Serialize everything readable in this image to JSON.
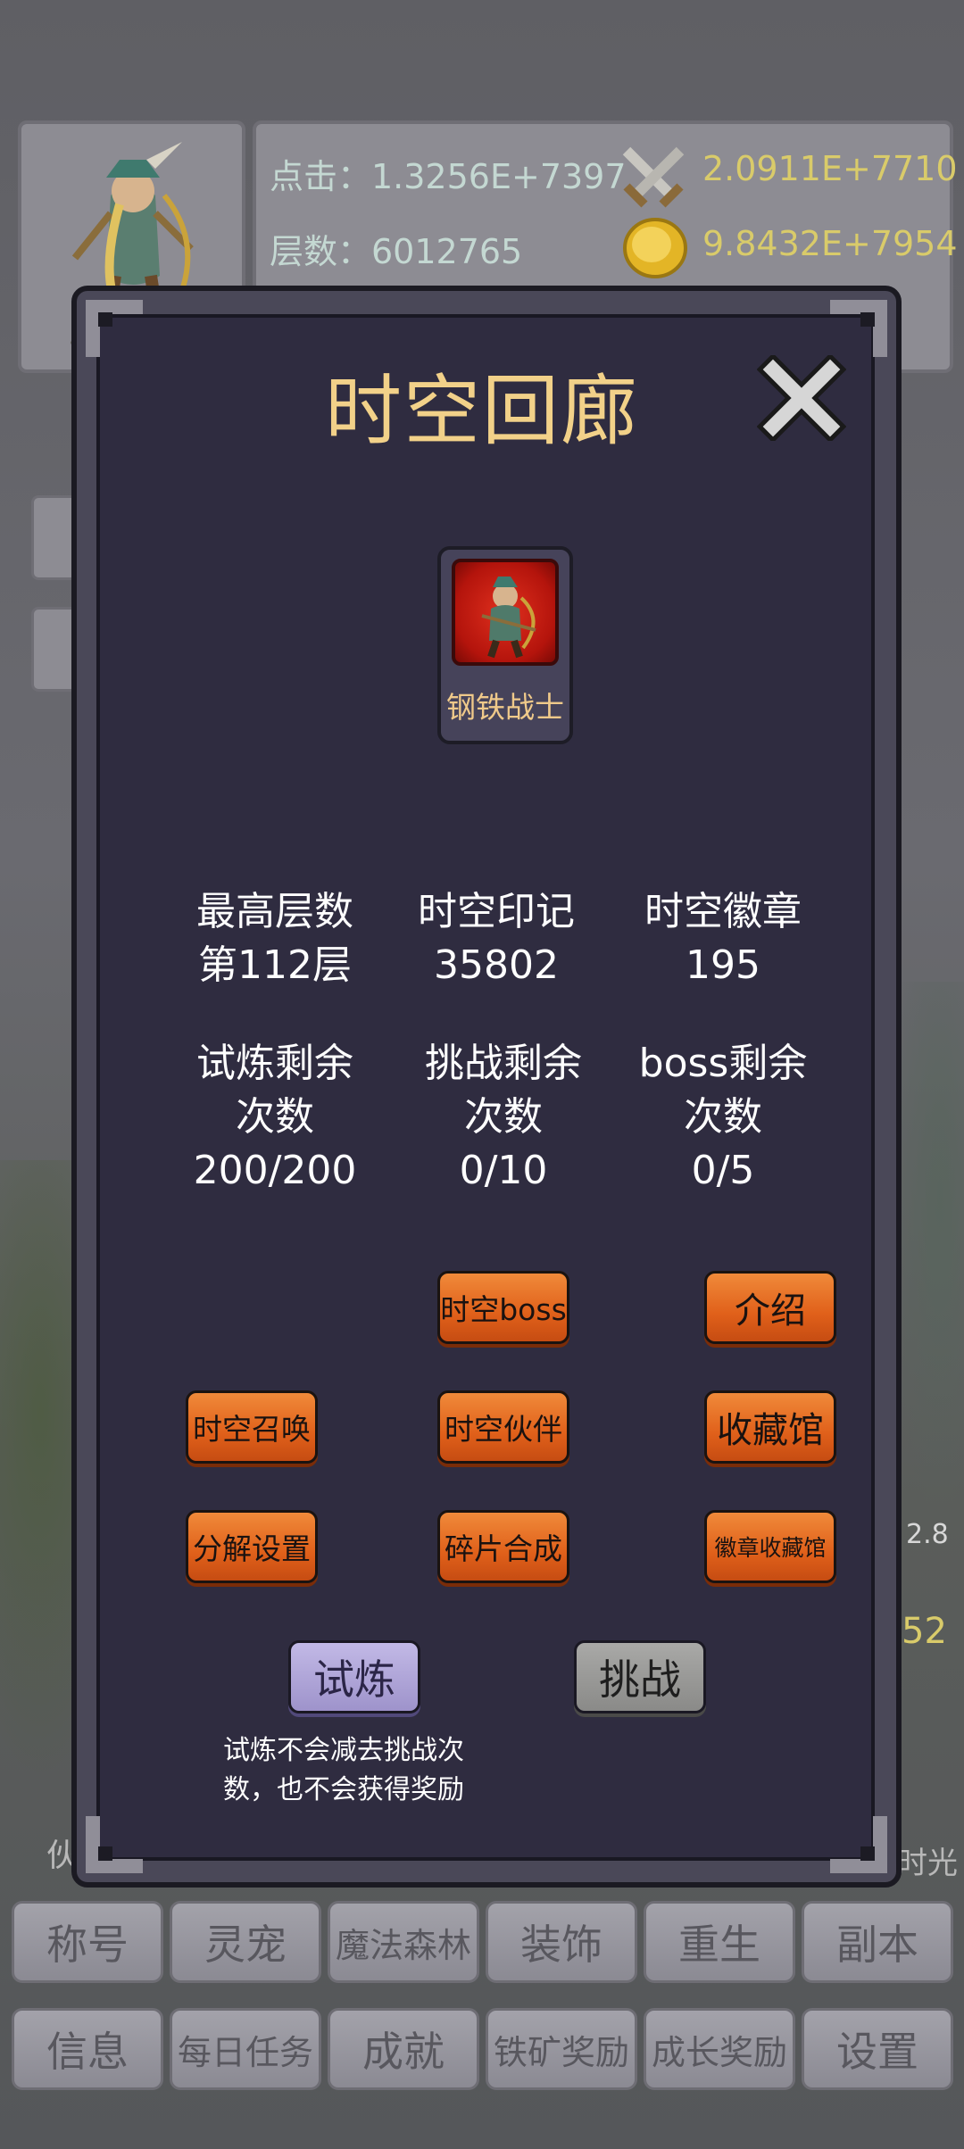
{
  "header": {
    "click_label": "点击：1.3256E+7397",
    "floor_label": "层数：6012765",
    "attack_value": "2.0911E+7710",
    "gold_value": "9.8432E+7954"
  },
  "background": {
    "side_value_1": "2.8",
    "side_value_2": "52",
    "side_text_left": "伙",
    "side_text_right": "时光"
  },
  "modal": {
    "title": "时空回廊",
    "character_name": "钢铁战士",
    "stats": [
      {
        "label": "最高层数",
        "value": "第112层"
      },
      {
        "label": "时空印记",
        "value": "35802"
      },
      {
        "label": "时空徽章",
        "value": "195"
      }
    ],
    "remaining": [
      {
        "label1": "试炼剩余",
        "label2": "次数",
        "value": "200/200"
      },
      {
        "label1": "挑战剩余",
        "label2": "次数",
        "value": "0/10"
      },
      {
        "label1": "boss剩余",
        "label2": "次数",
        "value": "0/5"
      }
    ],
    "buttons": {
      "boss": "时空boss",
      "intro": "介绍",
      "summon": "时空召唤",
      "partner": "时空伙伴",
      "collection": "收藏馆",
      "decompose": "分解设置",
      "fragment": "碎片合成",
      "badge_collection": "徽章收藏馆"
    },
    "trial": "试炼",
    "challenge": "挑战",
    "note": "试炼不会减去挑战次数，也不会获得奖励"
  },
  "menu": {
    "row1": [
      "称号",
      "灵宠",
      "魔法森林",
      "装饰",
      "重生",
      "副本"
    ],
    "row2": [
      "信息",
      "每日任务",
      "成就",
      "铁矿奖励",
      "成长奖励",
      "设置"
    ]
  },
  "colors": {
    "accent_orange": "#e0601a",
    "title_gold": "#f2d189",
    "modal_bg": "#2f2c40"
  }
}
